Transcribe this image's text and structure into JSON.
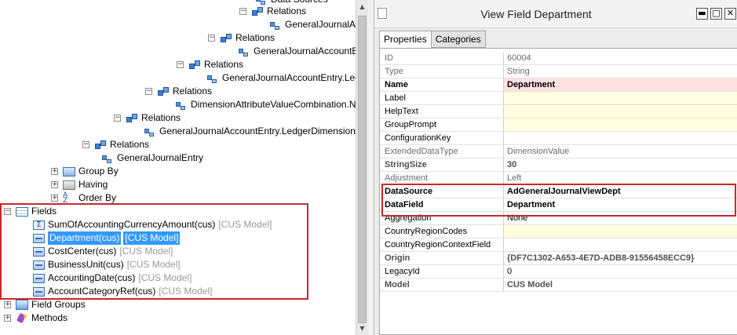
{
  "tree": {
    "nodes": [
      {
        "label": "Data Sources",
        "model": ""
      },
      {
        "label": "Relations",
        "model": ""
      },
      {
        "label": "GeneralJournalAc",
        "model": ""
      },
      {
        "label": "Relations",
        "model": ""
      },
      {
        "label": "GeneralJournalAccountE",
        "model": ""
      },
      {
        "label": "Relations",
        "model": ""
      },
      {
        "label": "GeneralJournalAccountEntry.Led",
        "model": ""
      },
      {
        "label": "Relations",
        "model": ""
      },
      {
        "label": "DimensionAttributeValueCombination.N",
        "model": ""
      },
      {
        "label": "Relations",
        "model": ""
      },
      {
        "label": "GeneralJournalAccountEntry.LedgerDimension",
        "model": ""
      },
      {
        "label": "Relations",
        "model": ""
      },
      {
        "label": "GeneralJournalEntry",
        "model": ""
      },
      {
        "label": "Group By",
        "model": ""
      },
      {
        "label": "Having",
        "model": ""
      },
      {
        "label": "Order By",
        "model": ""
      },
      {
        "label": "Fields",
        "model": ""
      },
      {
        "label": "SumOfAccountingCurrencyAmount(cus)",
        "model": "[CUS Model]"
      },
      {
        "label": "Department(cus)",
        "model": "[CUS Model]"
      },
      {
        "label": "CostCenter(cus)",
        "model": "[CUS Model]"
      },
      {
        "label": "BusinessUnit(cus)",
        "model": "[CUS Model]"
      },
      {
        "label": "AccountingDate(cus)",
        "model": "[CUS Model]"
      },
      {
        "label": "AccountCategoryRef(cus)",
        "model": "[CUS Model]"
      },
      {
        "label": "Field Groups",
        "model": ""
      },
      {
        "label": "Methods",
        "model": ""
      }
    ],
    "expand_plus": "+",
    "expand_minus": "−",
    "sum_icon_glyph": "Σ",
    "order_icon_glyph": "A\nZ"
  },
  "window": {
    "title": "View Field Department",
    "min_glyph": "▬",
    "max_glyph": "□",
    "close_glyph": "✕"
  },
  "tabs": [
    {
      "label": "Properties",
      "active": true
    },
    {
      "label": "Categories",
      "active": false
    }
  ],
  "properties": [
    {
      "name": "ID",
      "value": "60004",
      "style": "ro"
    },
    {
      "name": "Type",
      "value": "String",
      "style": "ro"
    },
    {
      "name": "Name",
      "value": "Department",
      "style": "bold mandatory"
    },
    {
      "name": "Label",
      "value": "",
      "style": "editable"
    },
    {
      "name": "HelpText",
      "value": "",
      "style": "editable"
    },
    {
      "name": "GroupPrompt",
      "value": "",
      "style": "editable"
    },
    {
      "name": "ConfigurationKey",
      "value": "",
      "style": ""
    },
    {
      "name": "ExtendedDataType",
      "value": "DimensionValue",
      "style": "ro"
    },
    {
      "name": "StringSize",
      "value": "30",
      "style": "grey-bold"
    },
    {
      "name": "Adjustment",
      "value": "Left",
      "style": "ro"
    },
    {
      "name": "DataSource",
      "value": "AdGeneralJournalViewDept",
      "style": "bold"
    },
    {
      "name": "DataField",
      "value": "Department",
      "style": "bold"
    },
    {
      "name": "Aggregation",
      "value": "None",
      "style": ""
    },
    {
      "name": "CountryRegionCodes",
      "value": "",
      "style": "editable"
    },
    {
      "name": "CountryRegionContextField",
      "value": "",
      "style": ""
    },
    {
      "name": "Origin",
      "value": "{DF7C1302-A653-4E7D-ADB8-91556458ECC9}",
      "style": "grey-bold"
    },
    {
      "name": "LegacyId",
      "value": "0",
      "style": ""
    },
    {
      "name": "Model",
      "value": "CUS Model",
      "style": "grey-bold"
    }
  ],
  "colors": {
    "highlight_box": "#c9282d",
    "selection": "#3399ff",
    "mandatory_bg": "#ffe0e0",
    "editable_bg": "#ffffe0"
  }
}
